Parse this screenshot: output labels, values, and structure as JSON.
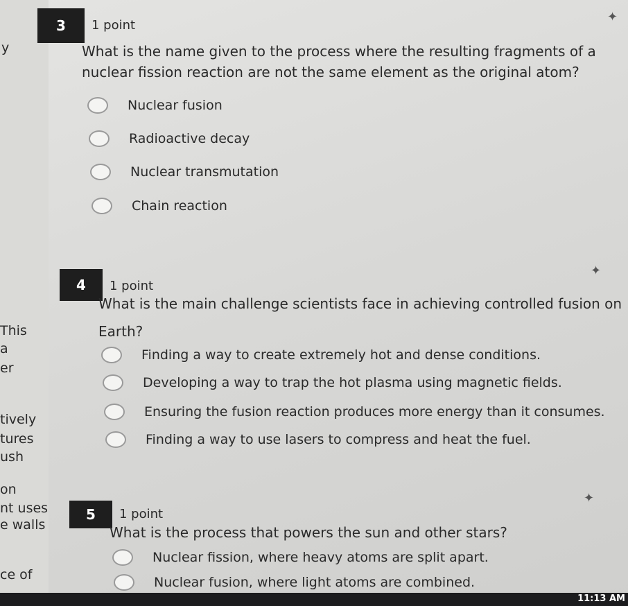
{
  "sidebar_fragments": [
    "y",
    "This",
    "a",
    "er",
    "tively",
    "tures",
    "ush",
    "on",
    "nt uses",
    "e walls",
    "ce of"
  ],
  "questions": [
    {
      "number": "3",
      "points": "1 point",
      "text_line1": "What is the name given to the process where the resulting fragments of a",
      "text_line2": "nuclear fission reaction are not the same element as the original atom?",
      "options": [
        "Nuclear fusion",
        "Radioactive decay",
        "Nuclear transmutation",
        "Chain reaction"
      ]
    },
    {
      "number": "4",
      "points": "1 point",
      "text_line1": "What is the main challenge scientists face in achieving controlled fusion on",
      "text_line2": "Earth?",
      "options": [
        "Finding a way to create extremely hot and dense conditions.",
        "Developing a way to trap the hot plasma using magnetic fields.",
        "Ensuring the fusion reaction produces more energy than it consumes.",
        "Finding a way to use lasers to compress and heat the fuel."
      ]
    },
    {
      "number": "5",
      "points": "1 point",
      "text_line1": "What is the process that powers the sun and other stars?",
      "text_line2": "",
      "options": [
        "Nuclear fission, where heavy atoms are split apart.",
        "Nuclear fusion, where light atoms are combined."
      ]
    }
  ],
  "taskbar": {
    "clock": "11:13 AM"
  }
}
